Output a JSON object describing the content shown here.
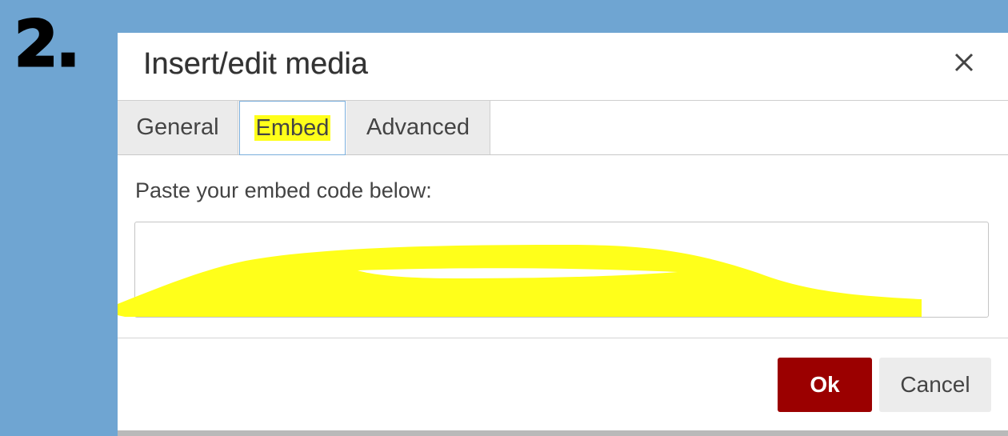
{
  "step_number": "2.",
  "dialog": {
    "title": "Insert/edit media",
    "close_icon": "close-icon"
  },
  "tabs": [
    {
      "label": "General",
      "selected": false
    },
    {
      "label": "Embed",
      "selected": true,
      "highlighted": true
    },
    {
      "label": "Advanced",
      "selected": false
    }
  ],
  "embed_panel": {
    "label": "Paste your embed code below:",
    "textarea_value": ""
  },
  "footer": {
    "ok_label": "Ok",
    "cancel_label": "Cancel"
  },
  "colors": {
    "background": "#6fa5d2",
    "ok_button": "#9b0000",
    "highlight": "#ffff1a",
    "tab_active_border": "#7aaedc"
  }
}
